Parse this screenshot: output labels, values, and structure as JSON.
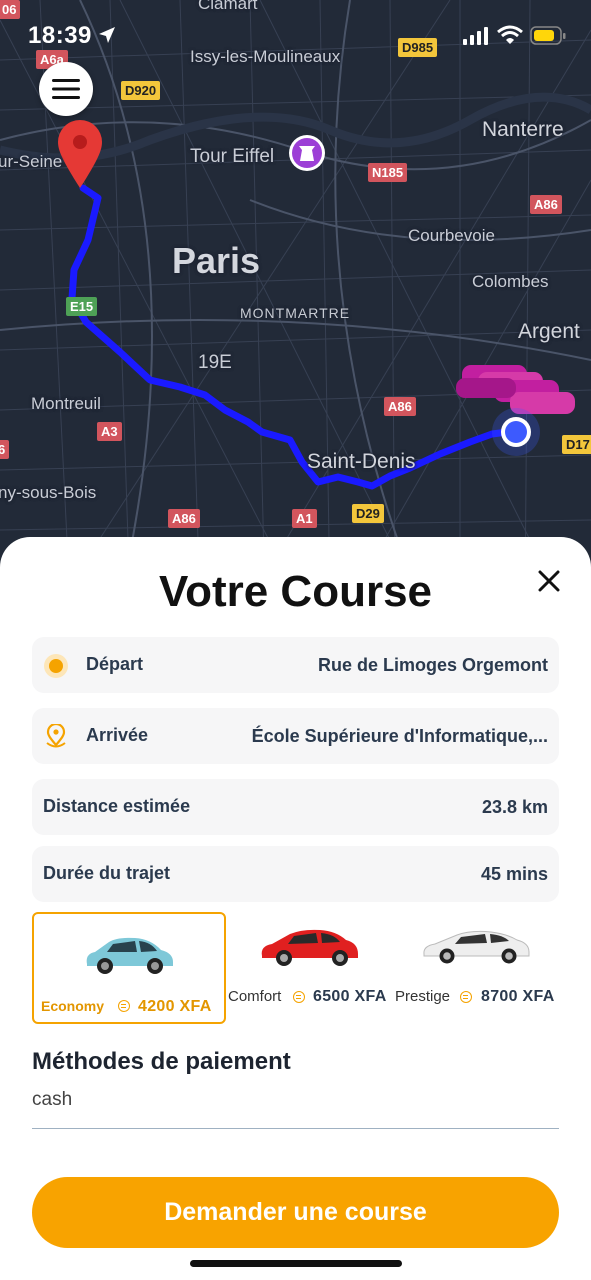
{
  "status_bar": {
    "time": "18:39"
  },
  "map": {
    "labels": {
      "clamart": "Clamart",
      "issy": "Issy-les-Moulineaux",
      "nanterre": "Nanterre",
      "tour_eiffel": "Tour Eiffel",
      "seine": "ur-Seine",
      "paris": "Paris",
      "courbevoie": "Courbevoie",
      "colombes": "Colombes",
      "montmartre": "MONTMARTRE",
      "argent": "Argent",
      "district": "19E",
      "montreuil": "Montreuil",
      "saint_denis": "Saint-Denis",
      "bois": "ny-sous-Bois"
    },
    "shields": {
      "s06": "06",
      "a6a": "A6a",
      "d985": "D985",
      "d920": "D920",
      "n185": "N185",
      "a86_1": "A86",
      "e15": "E15",
      "a86_2": "A86",
      "a3": "A3",
      "a86_3": "A86",
      "a1": "A1",
      "d29": "D29",
      "d17": "D17",
      "l6": "6"
    },
    "colors": {
      "route": "#1a1aff",
      "marker": "#e53935",
      "cars": "#c21fa0",
      "location": "#3d5afe"
    }
  },
  "sheet": {
    "title": "Votre Course",
    "depart": {
      "label": "Départ",
      "value": "Rue de Limoges Orgemont"
    },
    "arrivee": {
      "label": "Arrivée",
      "value": "École Supérieure d'Informatique,..."
    },
    "distance": {
      "label": "Distance estimée",
      "value": "23.8 km"
    },
    "duree": {
      "label": "Durée du trajet",
      "value": "45 mins"
    },
    "vehicles": [
      {
        "name": "Economy",
        "price": "4200 XFA",
        "color": "#7ec8d8",
        "selected": true
      },
      {
        "name": "Comfort",
        "price": "6500 XFA",
        "color": "#e02020",
        "selected": false
      },
      {
        "name": "Prestige",
        "price": "8700 XFA",
        "color": "#eeeeee",
        "selected": false
      }
    ],
    "payment": {
      "title": "Méthodes de paiement",
      "value": "cash"
    },
    "request_button": "Demander une course",
    "accent": "#f8a300"
  }
}
